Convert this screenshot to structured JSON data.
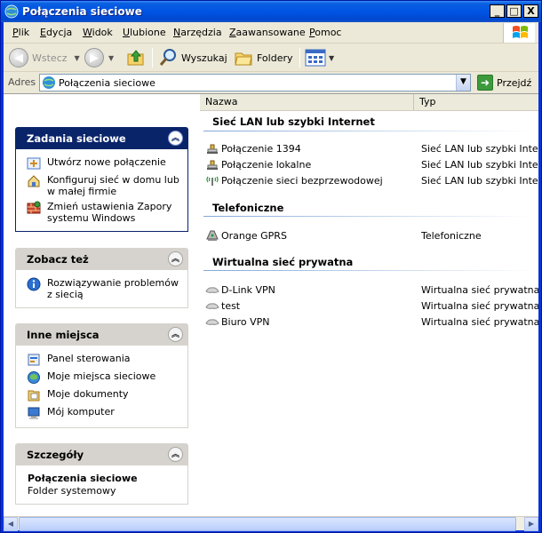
{
  "window": {
    "title": "Połączenia sieciowe"
  },
  "titlebar_buttons": {
    "minimize": "_",
    "maximize": "□",
    "close": "X"
  },
  "menu": [
    "Plik",
    "Edycja",
    "Widok",
    "Ulubione",
    "Narzędzia",
    "Zaawansowane",
    "Pomoc"
  ],
  "toolbar": {
    "back_label": "Wstecz",
    "search_label": "Wyszukaj",
    "folders_label": "Foldery"
  },
  "address": {
    "label": "Adres",
    "value": "Połączenia sieciowe",
    "go_label": "Przejdź"
  },
  "taskpane": {
    "network_tasks": {
      "title": "Zadania sieciowe",
      "items": [
        "Utwórz nowe połączenie",
        "Konfiguruj sieć w domu lub w małej firmie",
        "Zmień ustawienia Zapory systemu Windows"
      ]
    },
    "see_also": {
      "title": "Zobacz też",
      "items": [
        "Rozwiązywanie problemów z siecią"
      ]
    },
    "other_places": {
      "title": "Inne miejsca",
      "items": [
        "Panel sterowania",
        "Moje miejsca sieciowe",
        "Moje dokumenty",
        "Mój komputer"
      ]
    },
    "details": {
      "title": "Szczegóły",
      "name": "Połączenia sieciowe",
      "subtitle": "Folder systemowy"
    }
  },
  "filelist": {
    "columns": {
      "name": "Nazwa",
      "type": "Typ"
    },
    "groups": [
      {
        "title": "Sieć LAN lub szybki Internet",
        "rows": [
          {
            "name": "Połączenie 1394",
            "type": "Sieć LAN lub szybki Inter..."
          },
          {
            "name": "Połączenie lokalne",
            "type": "Sieć LAN lub szybki Inter..."
          },
          {
            "name": "Połączenie sieci bezprzewodowej",
            "type": "Sieć LAN lub szybki Inter..."
          }
        ]
      },
      {
        "title": "Telefoniczne",
        "rows": [
          {
            "name": "Orange GPRS",
            "type": "Telefoniczne"
          }
        ]
      },
      {
        "title": "Wirtualna sieć prywatna",
        "rows": [
          {
            "name": "D-Link VPN",
            "type": "Wirtualna sieć prywatna"
          },
          {
            "name": "test",
            "type": "Wirtualna sieć prywatna"
          },
          {
            "name": "Biuro VPN",
            "type": "Wirtualna sieć prywatna"
          }
        ]
      }
    ]
  },
  "colors": {
    "titlebar": "#0054e3",
    "taskpane_primary_header": "#0a246a",
    "taskpane_secondary_header": "#d6d3ce",
    "chrome": "#ece9d8"
  }
}
